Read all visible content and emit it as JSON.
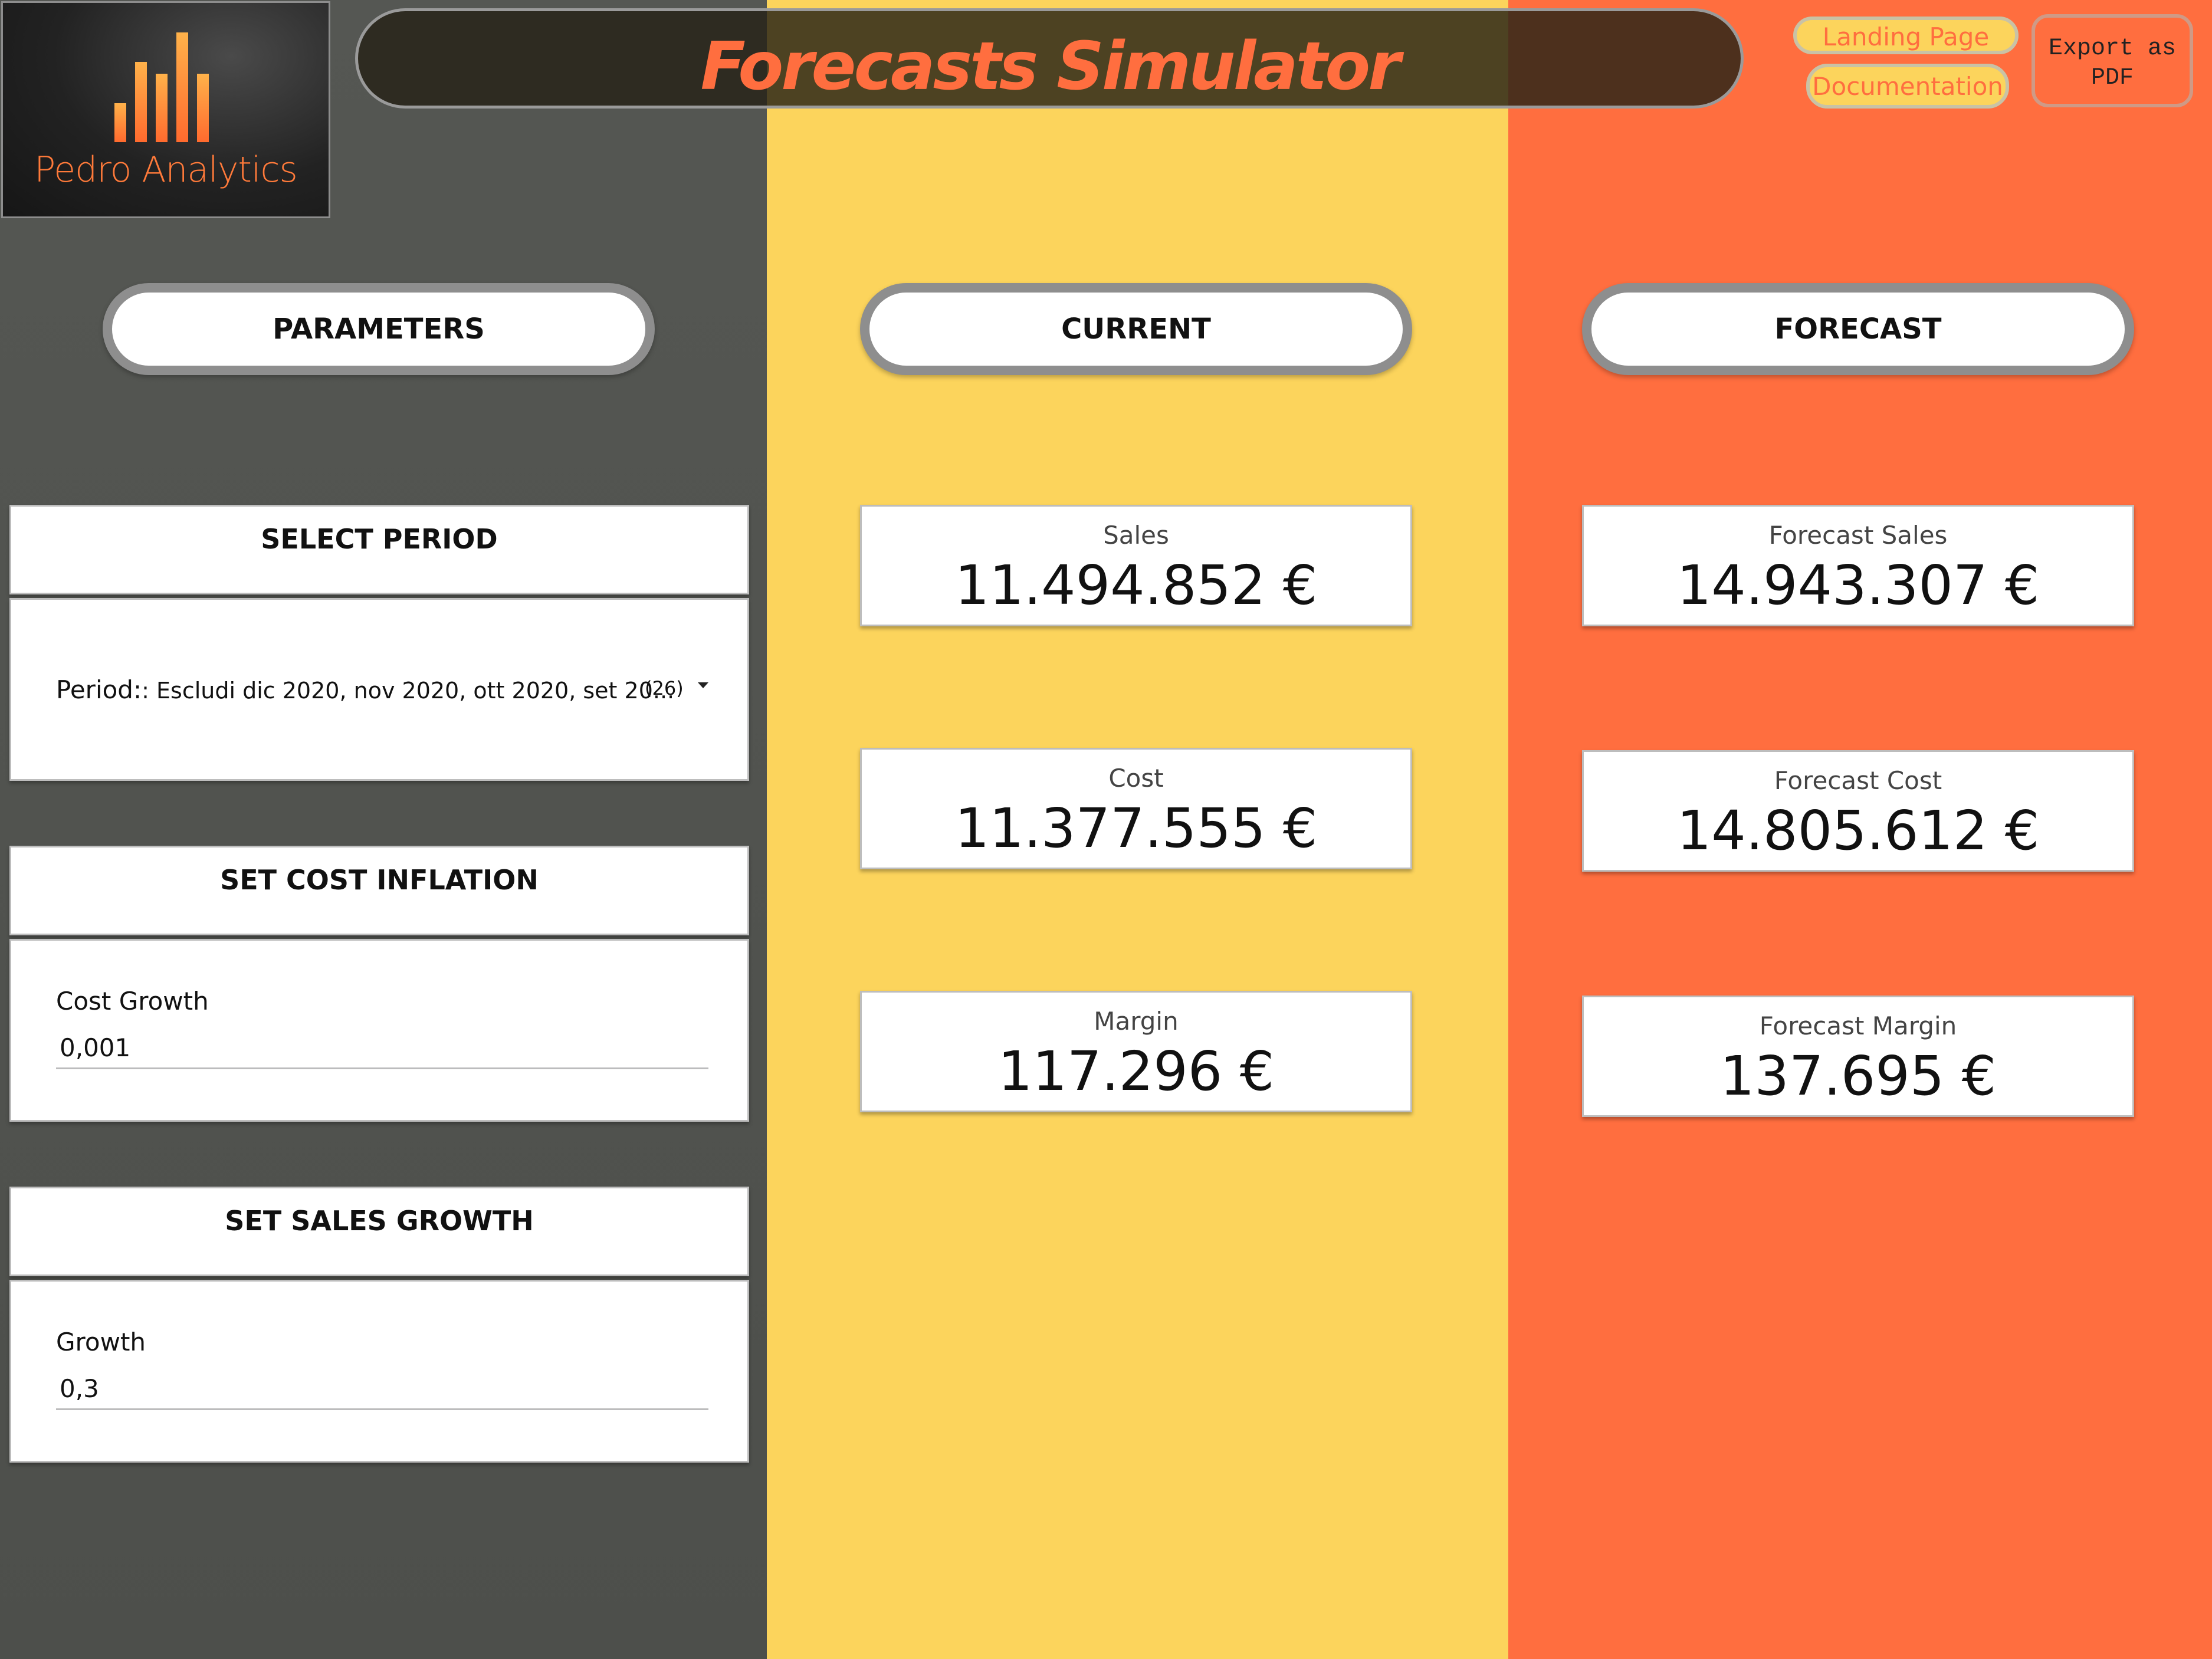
{
  "logo": {
    "text": "Pedro Analytics"
  },
  "header": {
    "title": "Forecasts Simulator",
    "landing_label": "Landing Page",
    "docs_label": "Documentation",
    "export_label": "Export as PDF"
  },
  "sections": {
    "parameters": "PARAMETERS",
    "current": "CURRENT",
    "forecast": "FORECAST"
  },
  "period": {
    "heading": "SELECT PERIOD",
    "label": "Period:",
    "value": ": Escludi dic 2020, nov 2020, ott 2020, set 20...",
    "count": "(26)"
  },
  "cost_inflation": {
    "heading": "SET COST INFLATION",
    "label": "Cost Growth",
    "value": "0,001"
  },
  "sales_growth": {
    "heading": "SET SALES GROWTH",
    "label": "Growth",
    "value": "0,3"
  },
  "current": {
    "sales": {
      "label": "Sales",
      "value": "11.494.852 €"
    },
    "cost": {
      "label": "Cost",
      "value": "11.377.555 €"
    },
    "margin": {
      "label": "Margin",
      "value": "117.296 €"
    }
  },
  "forecast": {
    "sales": {
      "label": "Forecast Sales",
      "value": "14.943.307 €"
    },
    "cost": {
      "label": "Forecast Cost",
      "value": "14.805.612 €"
    },
    "margin": {
      "label": "Forecast Margin",
      "value": "137.695 €"
    }
  },
  "colors": {
    "left_bg": "#50524e",
    "mid_bg": "#fcd45c",
    "right_bg": "#ff6e3f",
    "accent": "#ff6e3f"
  }
}
